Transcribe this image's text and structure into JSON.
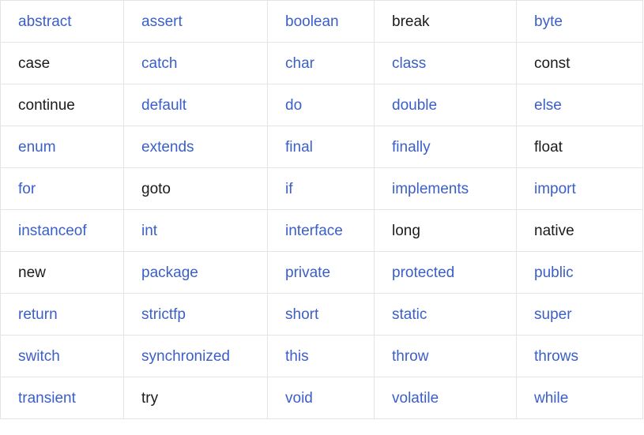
{
  "table": {
    "columns": 5,
    "rows": 10,
    "colors": {
      "link": "#3b5fc8",
      "plain": "#1b1b1b",
      "border": "#e4e4e4",
      "background": "#ffffff"
    },
    "cells": [
      [
        {
          "text": "abstract",
          "kind": "link"
        },
        {
          "text": "assert",
          "kind": "link"
        },
        {
          "text": "boolean",
          "kind": "link"
        },
        {
          "text": "break",
          "kind": "plain"
        },
        {
          "text": "byte",
          "kind": "link"
        }
      ],
      [
        {
          "text": "case",
          "kind": "plain"
        },
        {
          "text": "catch",
          "kind": "link"
        },
        {
          "text": "char",
          "kind": "link"
        },
        {
          "text": "class",
          "kind": "link"
        },
        {
          "text": "const",
          "kind": "plain"
        }
      ],
      [
        {
          "text": "continue",
          "kind": "plain"
        },
        {
          "text": "default",
          "kind": "link"
        },
        {
          "text": "do",
          "kind": "link"
        },
        {
          "text": "double",
          "kind": "link"
        },
        {
          "text": "else",
          "kind": "link"
        }
      ],
      [
        {
          "text": "enum",
          "kind": "link"
        },
        {
          "text": "extends",
          "kind": "link"
        },
        {
          "text": "final",
          "kind": "link"
        },
        {
          "text": "finally",
          "kind": "link"
        },
        {
          "text": "float",
          "kind": "plain"
        }
      ],
      [
        {
          "text": "for",
          "kind": "link"
        },
        {
          "text": "goto",
          "kind": "plain"
        },
        {
          "text": "if",
          "kind": "link"
        },
        {
          "text": "implements",
          "kind": "link"
        },
        {
          "text": "import",
          "kind": "link"
        }
      ],
      [
        {
          "text": "instanceof",
          "kind": "link"
        },
        {
          "text": "int",
          "kind": "link"
        },
        {
          "text": "interface",
          "kind": "link"
        },
        {
          "text": "long",
          "kind": "plain"
        },
        {
          "text": "native",
          "kind": "plain"
        }
      ],
      [
        {
          "text": "new",
          "kind": "plain"
        },
        {
          "text": "package",
          "kind": "link"
        },
        {
          "text": "private",
          "kind": "link"
        },
        {
          "text": "protected",
          "kind": "link"
        },
        {
          "text": "public",
          "kind": "link"
        }
      ],
      [
        {
          "text": "return",
          "kind": "link"
        },
        {
          "text": "strictfp",
          "kind": "link"
        },
        {
          "text": "short",
          "kind": "link"
        },
        {
          "text": "static",
          "kind": "link"
        },
        {
          "text": "super",
          "kind": "link"
        }
      ],
      [
        {
          "text": "switch",
          "kind": "link"
        },
        {
          "text": "synchronized",
          "kind": "link"
        },
        {
          "text": "this",
          "kind": "link"
        },
        {
          "text": "throw",
          "kind": "link"
        },
        {
          "text": "throws",
          "kind": "link"
        }
      ],
      [
        {
          "text": "transient",
          "kind": "link"
        },
        {
          "text": "try",
          "kind": "plain"
        },
        {
          "text": "void",
          "kind": "link"
        },
        {
          "text": "volatile",
          "kind": "link"
        },
        {
          "text": "while",
          "kind": "link"
        }
      ]
    ]
  }
}
